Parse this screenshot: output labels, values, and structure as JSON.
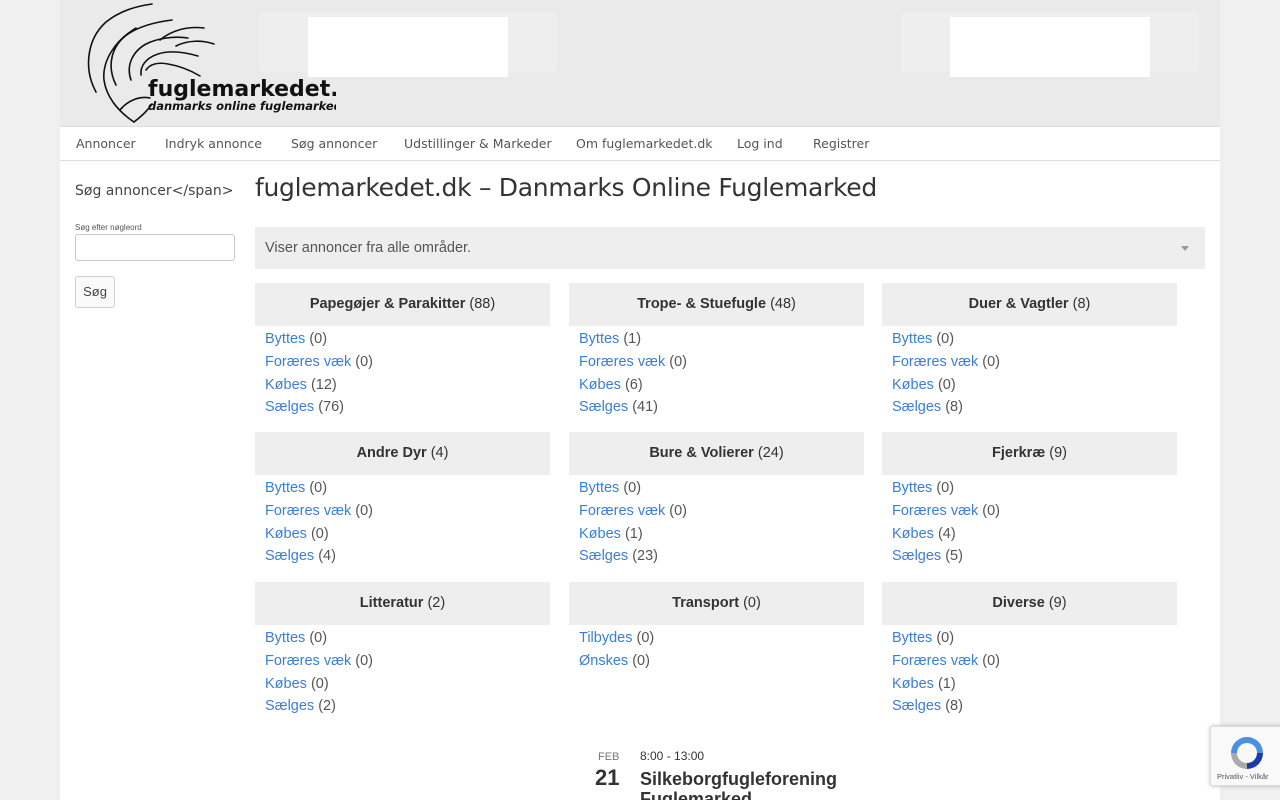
{
  "logo": {
    "name": "fuglemarkedet.dk",
    "tagline": "danmarks online fuglemarked"
  },
  "nav": {
    "items": [
      "Annoncer",
      "Indryk annonce",
      "Søg annoncer",
      "Udstillinger & Markeder",
      "Om fuglemarkedet.dk",
      "Log ind",
      "Registrer"
    ]
  },
  "sidebar": {
    "title": "Søg annoncer</span>",
    "keyword_label": "Søg efter nøgleord",
    "keyword_value": "",
    "search_button": "Søg"
  },
  "main": {
    "title": "fuglemarkedet.dk – Danmarks Online Fuglemarked",
    "region_text": "Viser annoncer fra alle områder."
  },
  "categories": [
    {
      "name": "Papegøjer & Parakitter",
      "count": "(88)",
      "items": [
        [
          "Byttes",
          "(0)"
        ],
        [
          "Foræres væk",
          "(0)"
        ],
        [
          "Købes",
          "(12)"
        ],
        [
          "Sælges",
          "(76)"
        ]
      ]
    },
    {
      "name": "Trope- & Stuefugle",
      "count": "(48)",
      "items": [
        [
          "Byttes",
          "(1)"
        ],
        [
          "Foræres væk",
          "(0)"
        ],
        [
          "Købes",
          "(6)"
        ],
        [
          "Sælges",
          "(41)"
        ]
      ]
    },
    {
      "name": "Duer & Vagtler",
      "count": "(8)",
      "items": [
        [
          "Byttes",
          "(0)"
        ],
        [
          "Foræres væk",
          "(0)"
        ],
        [
          "Købes",
          "(0)"
        ],
        [
          "Sælges",
          "(8)"
        ]
      ]
    },
    {
      "name": "Andre Dyr",
      "count": "(4)",
      "items": [
        [
          "Byttes",
          "(0)"
        ],
        [
          "Foræres væk",
          "(0)"
        ],
        [
          "Købes",
          "(0)"
        ],
        [
          "Sælges",
          "(4)"
        ]
      ]
    },
    {
      "name": "Bure & Volierer",
      "count": "(24)",
      "items": [
        [
          "Byttes",
          "(0)"
        ],
        [
          "Foræres væk",
          "(0)"
        ],
        [
          "Købes",
          "(1)"
        ],
        [
          "Sælges",
          "(23)"
        ]
      ]
    },
    {
      "name": "Fjerkræ",
      "count": "(9)",
      "items": [
        [
          "Byttes",
          "(0)"
        ],
        [
          "Foræres væk",
          "(0)"
        ],
        [
          "Købes",
          "(4)"
        ],
        [
          "Sælges",
          "(5)"
        ]
      ]
    },
    {
      "name": "Litteratur",
      "count": "(2)",
      "items": [
        [
          "Byttes",
          "(0)"
        ],
        [
          "Foræres væk",
          "(0)"
        ],
        [
          "Købes",
          "(0)"
        ],
        [
          "Sælges",
          "(2)"
        ]
      ]
    },
    {
      "name": "Transport",
      "count": "(0)",
      "items": [
        [
          "Tilbydes",
          "(0)"
        ],
        [
          "Ønskes",
          "(0)"
        ]
      ]
    },
    {
      "name": "Diverse",
      "count": "(9)",
      "items": [
        [
          "Byttes",
          "(0)"
        ],
        [
          "Foræres væk",
          "(0)"
        ],
        [
          "Købes",
          "(1)"
        ],
        [
          "Sælges",
          "(8)"
        ]
      ]
    }
  ],
  "event": {
    "month": "FEB",
    "day": "21",
    "time": "8:00 - 13:00",
    "title": "Silkeborgfugleforening Fuglemarked"
  },
  "recaptcha": {
    "footer": "Privatliv - Vilkår"
  },
  "colors": {
    "link": "#3a7fd5",
    "header_bg": "#eaeaea",
    "category_header_bg": "#eeeeee"
  }
}
